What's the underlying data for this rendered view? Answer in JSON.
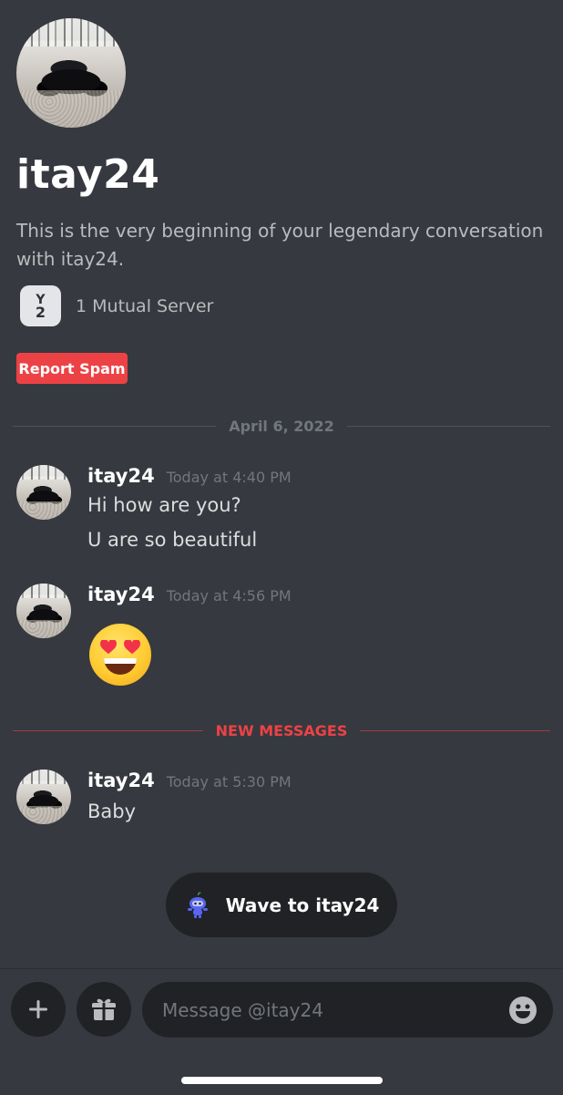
{
  "profile": {
    "username": "itay24",
    "intro": "This is the very beginning of your legendary conversation with itay24.",
    "mutual_server_icon_top": "Y",
    "mutual_server_icon_num": "2",
    "mutual_servers": "1 Mutual Server",
    "report_button": "Report Spam"
  },
  "date_divider": "April 6, 2022",
  "new_messages_divider": "NEW MESSAGES",
  "messages": [
    {
      "author": "itay24",
      "time": "Today at 4:40 PM",
      "lines": [
        "Hi how are you?",
        "U are so beautiful"
      ]
    },
    {
      "author": "itay24",
      "time": "Today at 4:56 PM",
      "emoji": "smiling-face-with-heart-eyes"
    },
    {
      "author": "itay24",
      "time": "Today at 5:30 PM",
      "lines": [
        "Baby"
      ]
    }
  ],
  "wave_button": "Wave to itay24",
  "composer": {
    "placeholder": "Message @itay24",
    "add_icon": "plus-icon",
    "gift_icon": "gift-icon",
    "emoji_icon": "emoji-icon"
  },
  "colors": {
    "background": "#36393f",
    "danger": "#ed4245",
    "dark": "#202225",
    "muted": "#72767d"
  }
}
